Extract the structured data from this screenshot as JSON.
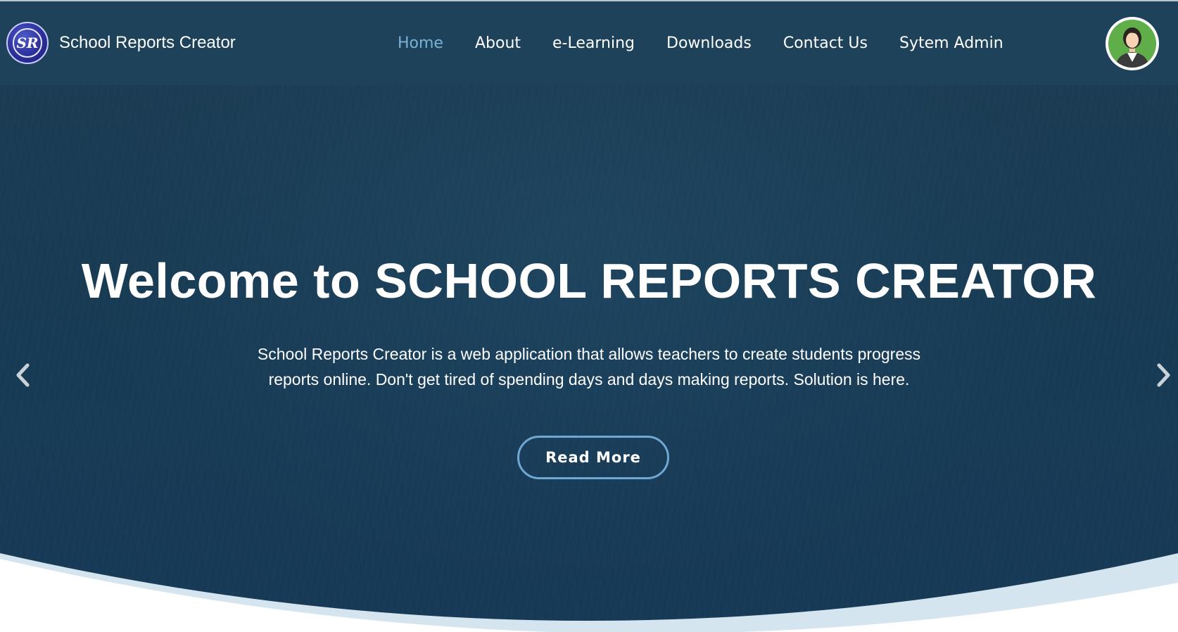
{
  "header": {
    "brand_name": "School Reports Creator",
    "logo_text": "SR",
    "nav": [
      {
        "label": "Home",
        "active": true
      },
      {
        "label": "About",
        "active": false
      },
      {
        "label": "e-Learning",
        "active": false
      },
      {
        "label": "Downloads",
        "active": false
      },
      {
        "label": "Contact Us",
        "active": false
      },
      {
        "label": "Sytem Admin",
        "active": false
      }
    ],
    "avatar_icon": "user-avatar-icon"
  },
  "hero": {
    "title": "Welcome to SCHOOL REPORTS CREATOR",
    "subtitle_line1": "School Reports Creator is a web application that allows teachers to create students progress",
    "subtitle_line2": "reports online. Don't get tired of spending days and days making reports. Solution is here.",
    "button_label": "Read More",
    "prev_icon": "chevron-left-icon",
    "next_icon": "chevron-right-icon"
  },
  "colors": {
    "header_bg": "#1e4259",
    "hero_bg": "#183b55",
    "nav_active": "#7ab3d9",
    "button_border": "#6fa8d3",
    "wave_light": "#d4e5ef"
  }
}
